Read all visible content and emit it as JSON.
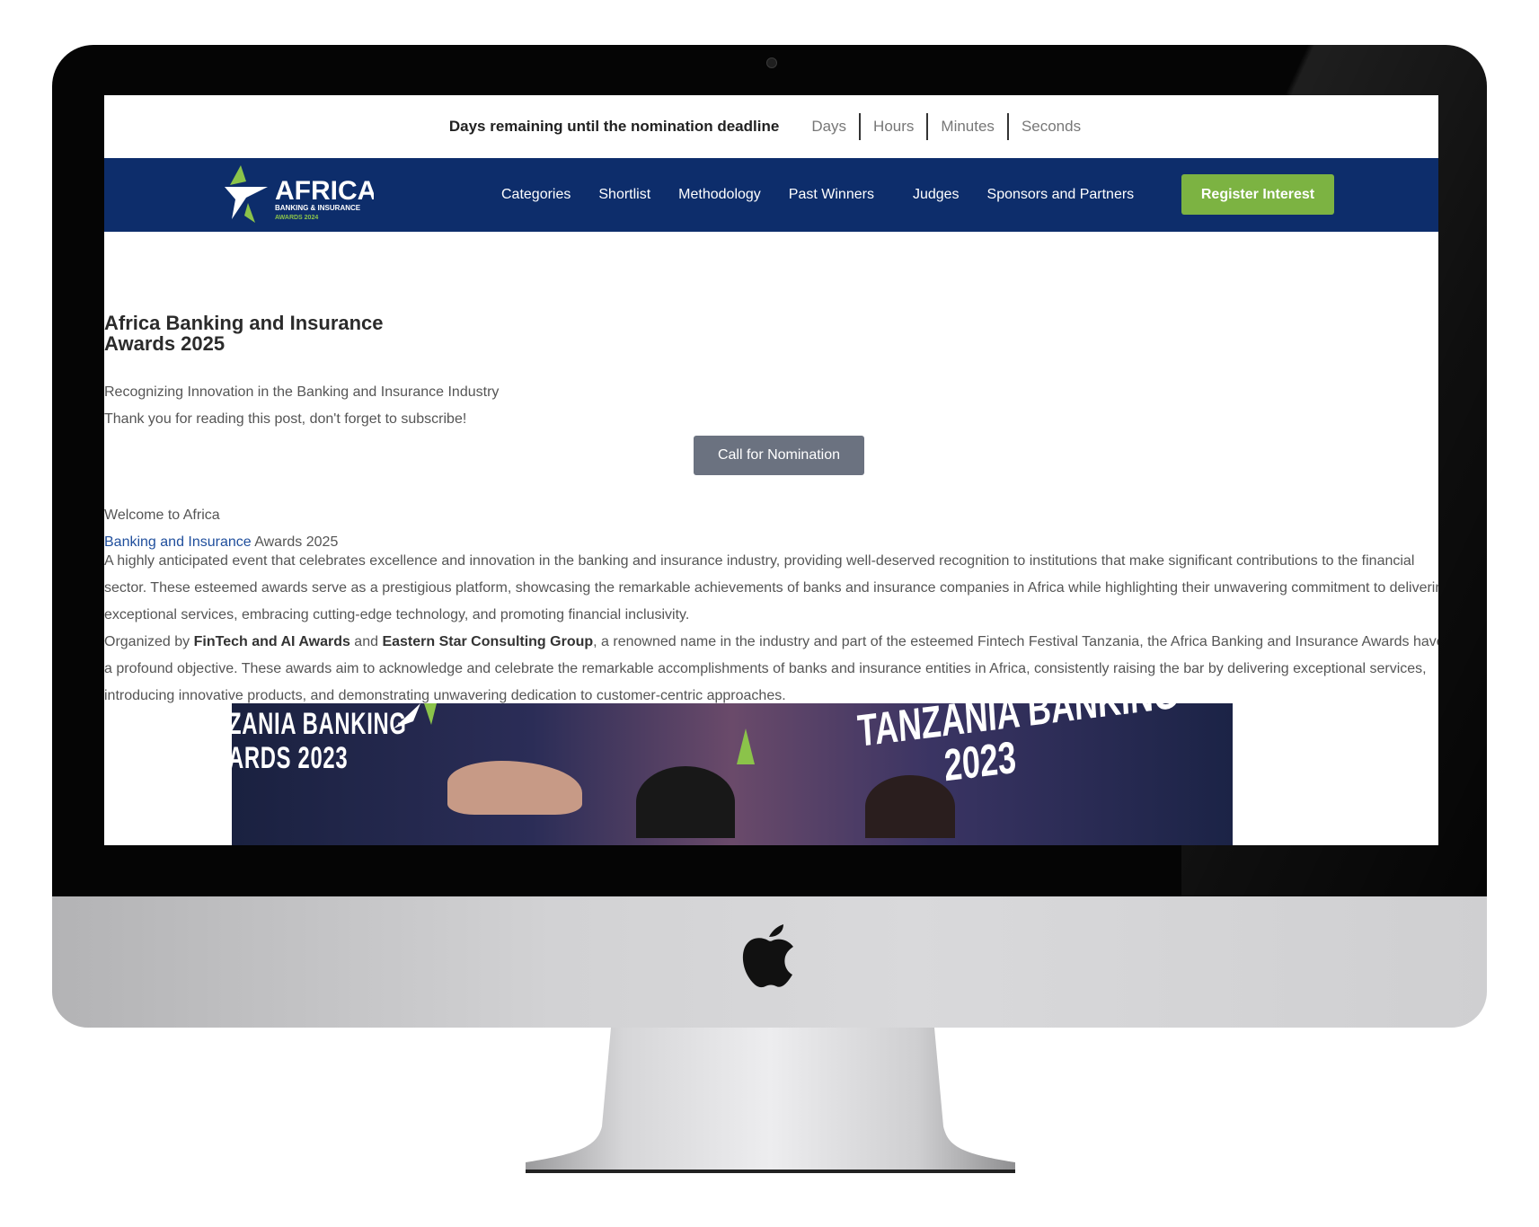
{
  "countdown": {
    "label": "Days remaining until the nomination deadline",
    "units": [
      "Days",
      "Hours",
      "Minutes",
      "Seconds"
    ]
  },
  "nav": {
    "logo": {
      "word": "AFRICA",
      "line2": "BANKING & INSURANCE",
      "line3": "AWARDS 2024"
    },
    "links": [
      "Categories",
      "Shortlist",
      "Methodology",
      "Past Winners",
      "Judges",
      "Sponsors and Partners"
    ],
    "register_label": "Register Interest",
    "accent_color": "#7cb342",
    "bar_color": "#0d2d6b"
  },
  "hero": {
    "title_line1": "Africa Banking and Insurance",
    "title_line2": "Awards 2025",
    "subtitle": "Recognizing Innovation in the Banking and Insurance Industry",
    "thanks": "Thank you for reading this post, don't forget to subscribe!",
    "cta_label": "Call for Nomination"
  },
  "content": {
    "welcome": "Welcome to Africa",
    "bi_link": "Banking and Insurance",
    "bi_rest": " Awards 2025",
    "para1": "A highly anticipated event that celebrates excellence and innovation in the banking and insurance industry, providing well-deserved recognition to institutions that make significant contributions to the financial sector. These esteemed awards serve as a prestigious platform, showcasing the remarkable achievements of banks and insurance companies in Africa while highlighting their unwavering commitment to delivering exceptional services, embracing cutting-edge technology, and promoting financial inclusivity.",
    "para2_prefix": "Organized by ",
    "para2_org1": "FinTech and AI Awards",
    "para2_and": " and ",
    "para2_org2": "Eastern Star Consulting Group",
    "para2_rest": ", a renowned name in the industry and part of the esteemed Fintech Festival Tanzania, the Africa Banking and Insurance Awards have a profound objective. These awards aim to acknowledge and celebrate the remarkable accomplishments of banks and insurance entities in Africa, consistently raising the bar by delivering exceptional services, introducing innovative products, and demonstrating unwavering dedication to customer-centric approaches."
  },
  "banner": {
    "left_text_1": "ZANIA BANKING",
    "left_text_2": "ARDS 2023",
    "right_text_1": "TANZANIA BANKING",
    "right_text_2": "2023"
  }
}
